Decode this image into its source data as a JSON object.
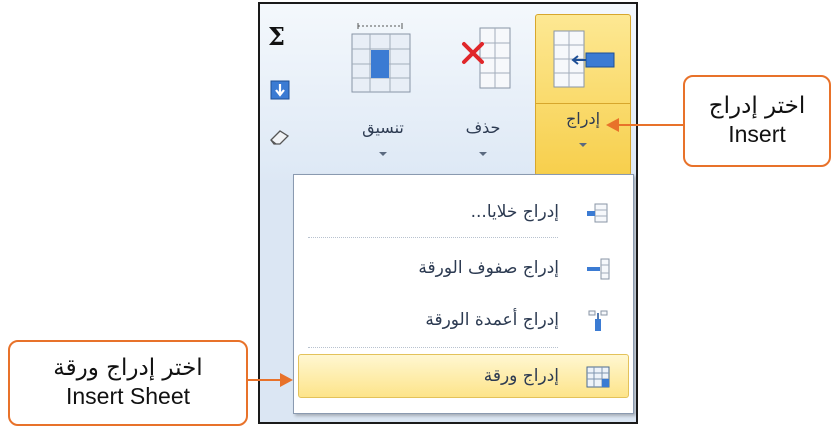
{
  "ribbon": {
    "sum_symbol": "Σ",
    "buttons": [
      {
        "label": "إدراج",
        "icon": "insert-cells-icon"
      },
      {
        "label": "حذف",
        "icon": "delete-cells-icon"
      },
      {
        "label": "تنسيق",
        "icon": "format-cells-icon"
      }
    ]
  },
  "menu": {
    "items": [
      {
        "label": "إدراج خلايا...",
        "icon": "insert-cells-small-icon"
      },
      {
        "label": "إدراج صفوف الورقة",
        "icon": "insert-rows-icon"
      },
      {
        "label": "إدراج أعمدة الورقة",
        "icon": "insert-columns-icon"
      },
      {
        "label": "إدراج ورقة",
        "icon": "insert-sheet-icon"
      }
    ]
  },
  "callouts": {
    "insert": {
      "arabic": "اختر إدراج",
      "english": "Insert"
    },
    "insert_sheet": {
      "arabic": "اختر إدراج ورقة",
      "english": "Insert Sheet"
    }
  },
  "colors": {
    "accent": "#e8722a",
    "highlight": "#f7cf4c",
    "ribbon": "#dde8f5"
  }
}
